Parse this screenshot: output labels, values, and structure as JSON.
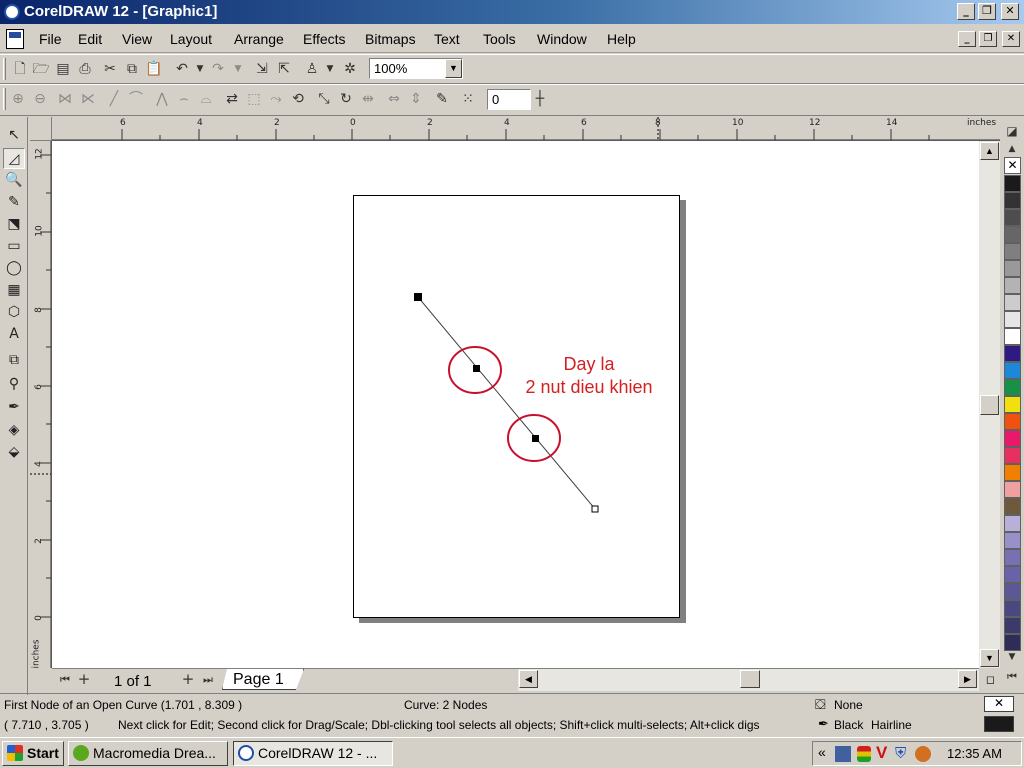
{
  "window": {
    "title": "CorelDRAW 12 - [Graphic1]",
    "controls": [
      "_",
      "❐",
      "✕"
    ],
    "doc_controls": [
      "_",
      "❐",
      "✕"
    ]
  },
  "menu": [
    "File",
    "Edit",
    "View",
    "Layout",
    "Arrange",
    "Effects",
    "Bitmaps",
    "Text",
    "Tools",
    "Window",
    "Help"
  ],
  "standard_toolbar": {
    "zoom_value": "100%",
    "zoom_arrow": "▼"
  },
  "property_bar": {
    "node_value": "0"
  },
  "rulers": {
    "unit": "inches",
    "vertical_unit": "inches",
    "h_ticks": [
      "6",
      "4",
      "2",
      "0",
      "2",
      "4",
      "6",
      "8",
      "10",
      "12",
      "14"
    ],
    "v_ticks": [
      "12",
      "10",
      "8",
      "6",
      "4",
      "2",
      "0"
    ]
  },
  "annotation": {
    "line1": "Day la",
    "line2": "2 nut dieu khien",
    "color": "#d42020"
  },
  "page_nav": {
    "first": "⏮",
    "add_before": "+",
    "page_count": "1 of 1",
    "add_after": "+",
    "last": "⏭",
    "tab_label": "Page 1"
  },
  "status": {
    "object_info": "First Node of an Open Curve (1.701 , 8.309 )",
    "node_info": "Curve: 2 Nodes",
    "fill": "None",
    "coords": "( 7.710 , 3.705  )",
    "hint": "Next click for Edit; Second click for Drag/Scale; Dbl-clicking tool selects all objects; Shift+click multi-selects; Alt+click digs",
    "outline_color": "Black",
    "outline_width": "Hairline"
  },
  "taskbar": {
    "start": "Start",
    "tasks": [
      "Macromedia Drea...",
      "CorelDRAW 12 - ..."
    ],
    "chevron": "«",
    "clock": "12:35 AM"
  },
  "palette_colors": [
    "#1a1a1a",
    "#333333",
    "#4d4d4d",
    "#666666",
    "#7f7f7f",
    "#999999",
    "#b3b3b3",
    "#cccccc",
    "#e6e6e6",
    "#ffffff",
    "#2e1a80",
    "#1e88d8",
    "#189048",
    "#f0e010",
    "#f05010",
    "#e8186a",
    "#e83060",
    "#f08000",
    "#f0a0a0",
    "#6c5a3a",
    "#b8b0d8",
    "#9890c8",
    "#7870b0",
    "#6a62a8",
    "#5c5896",
    "#4a4880",
    "#3c3a6a",
    "#2e2c58"
  ]
}
